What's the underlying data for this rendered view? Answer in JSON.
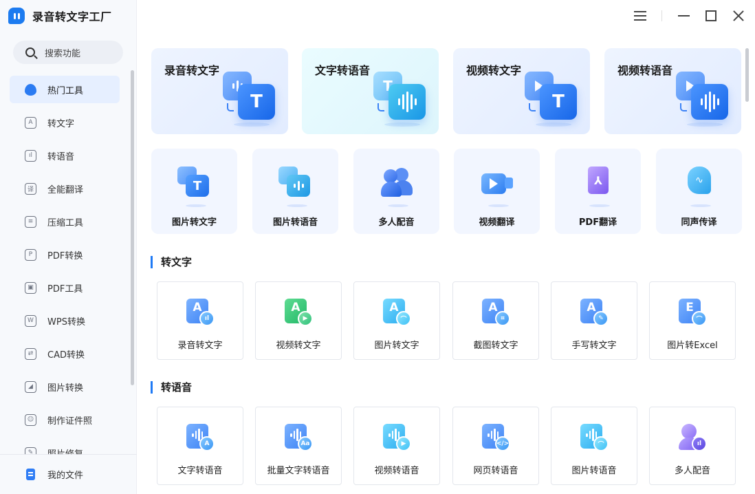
{
  "app": {
    "title": "录音转文字工厂"
  },
  "sidebar": {
    "search_label": "搜索功能",
    "items": [
      {
        "label": "热门工具",
        "icon": "fire-icon",
        "glyph": "",
        "active": true
      },
      {
        "label": "转文字",
        "icon": "text-icon",
        "glyph": "A"
      },
      {
        "label": "转语音",
        "icon": "voice-icon",
        "glyph": "ıl"
      },
      {
        "label": "全能翻译",
        "icon": "translate-icon",
        "glyph": "译"
      },
      {
        "label": "压缩工具",
        "icon": "compress-icon",
        "glyph": "≡"
      },
      {
        "label": "PDF转换",
        "icon": "pdf-convert-icon",
        "glyph": "P"
      },
      {
        "label": "PDF工具",
        "icon": "toolbox-icon",
        "glyph": "▣"
      },
      {
        "label": "WPS转换",
        "icon": "wps-icon",
        "glyph": "W"
      },
      {
        "label": "CAD转换",
        "icon": "cad-icon",
        "glyph": "⇄"
      },
      {
        "label": "图片转换",
        "icon": "image-icon",
        "glyph": "◢"
      },
      {
        "label": "制作证件照",
        "icon": "id-photo-icon",
        "glyph": "☺"
      },
      {
        "label": "照片修复",
        "icon": "photo-repair-icon",
        "glyph": "✎"
      }
    ],
    "my_files": "我的文件"
  },
  "hero": [
    {
      "title": "录音转文字",
      "from": "bars",
      "to": "T"
    },
    {
      "title": "文字转语音",
      "from": "T",
      "to": "bars"
    },
    {
      "title": "视频转文字",
      "from": "play",
      "to": "T"
    },
    {
      "title": "视频转语音",
      "from": "play",
      "to": "bars"
    }
  ],
  "quick": [
    {
      "label": "图片转文字",
      "icon": "image-to-text-icon"
    },
    {
      "label": "图片转语音",
      "icon": "image-to-voice-icon"
    },
    {
      "label": "多人配音",
      "icon": "multi-voice-icon"
    },
    {
      "label": "视频翻译",
      "icon": "video-translate-icon"
    },
    {
      "label": "PDF翻译",
      "icon": "pdf-translate-icon"
    },
    {
      "label": "同声传译",
      "icon": "simultaneous-interpret-icon"
    }
  ],
  "sections": [
    {
      "title": "转文字",
      "tools": [
        {
          "label": "录音转文字",
          "letter": "A",
          "badge": "ıl",
          "color": "blue"
        },
        {
          "label": "视频转文字",
          "letter": "A",
          "badge": "▶",
          "color": "green"
        },
        {
          "label": "图片转文字",
          "letter": "A",
          "badge": "⌒",
          "color": "cyan"
        },
        {
          "label": "截图转文字",
          "letter": "A",
          "badge": "⌗",
          "color": "blue"
        },
        {
          "label": "手写转文字",
          "letter": "A",
          "badge": "✎",
          "color": "blue"
        },
        {
          "label": "图片转Excel",
          "letter": "E",
          "badge": "⌒",
          "color": "blue"
        }
      ]
    },
    {
      "title": "转语音",
      "tools": [
        {
          "label": "文字转语音",
          "letter": "",
          "badge": "A",
          "color": "blue"
        },
        {
          "label": "批量文字转语音",
          "letter": "",
          "badge": "Aa",
          "color": "blue"
        },
        {
          "label": "视频转语音",
          "letter": "",
          "badge": "▶",
          "color": "cyan"
        },
        {
          "label": "网页转语音",
          "letter": "",
          "badge": "</>",
          "color": "blue"
        },
        {
          "label": "图片转语音",
          "letter": "",
          "badge": "⌒",
          "color": "cyan"
        },
        {
          "label": "多人配音",
          "letter": "",
          "badge": "ıl",
          "color": "purple"
        }
      ]
    }
  ]
}
